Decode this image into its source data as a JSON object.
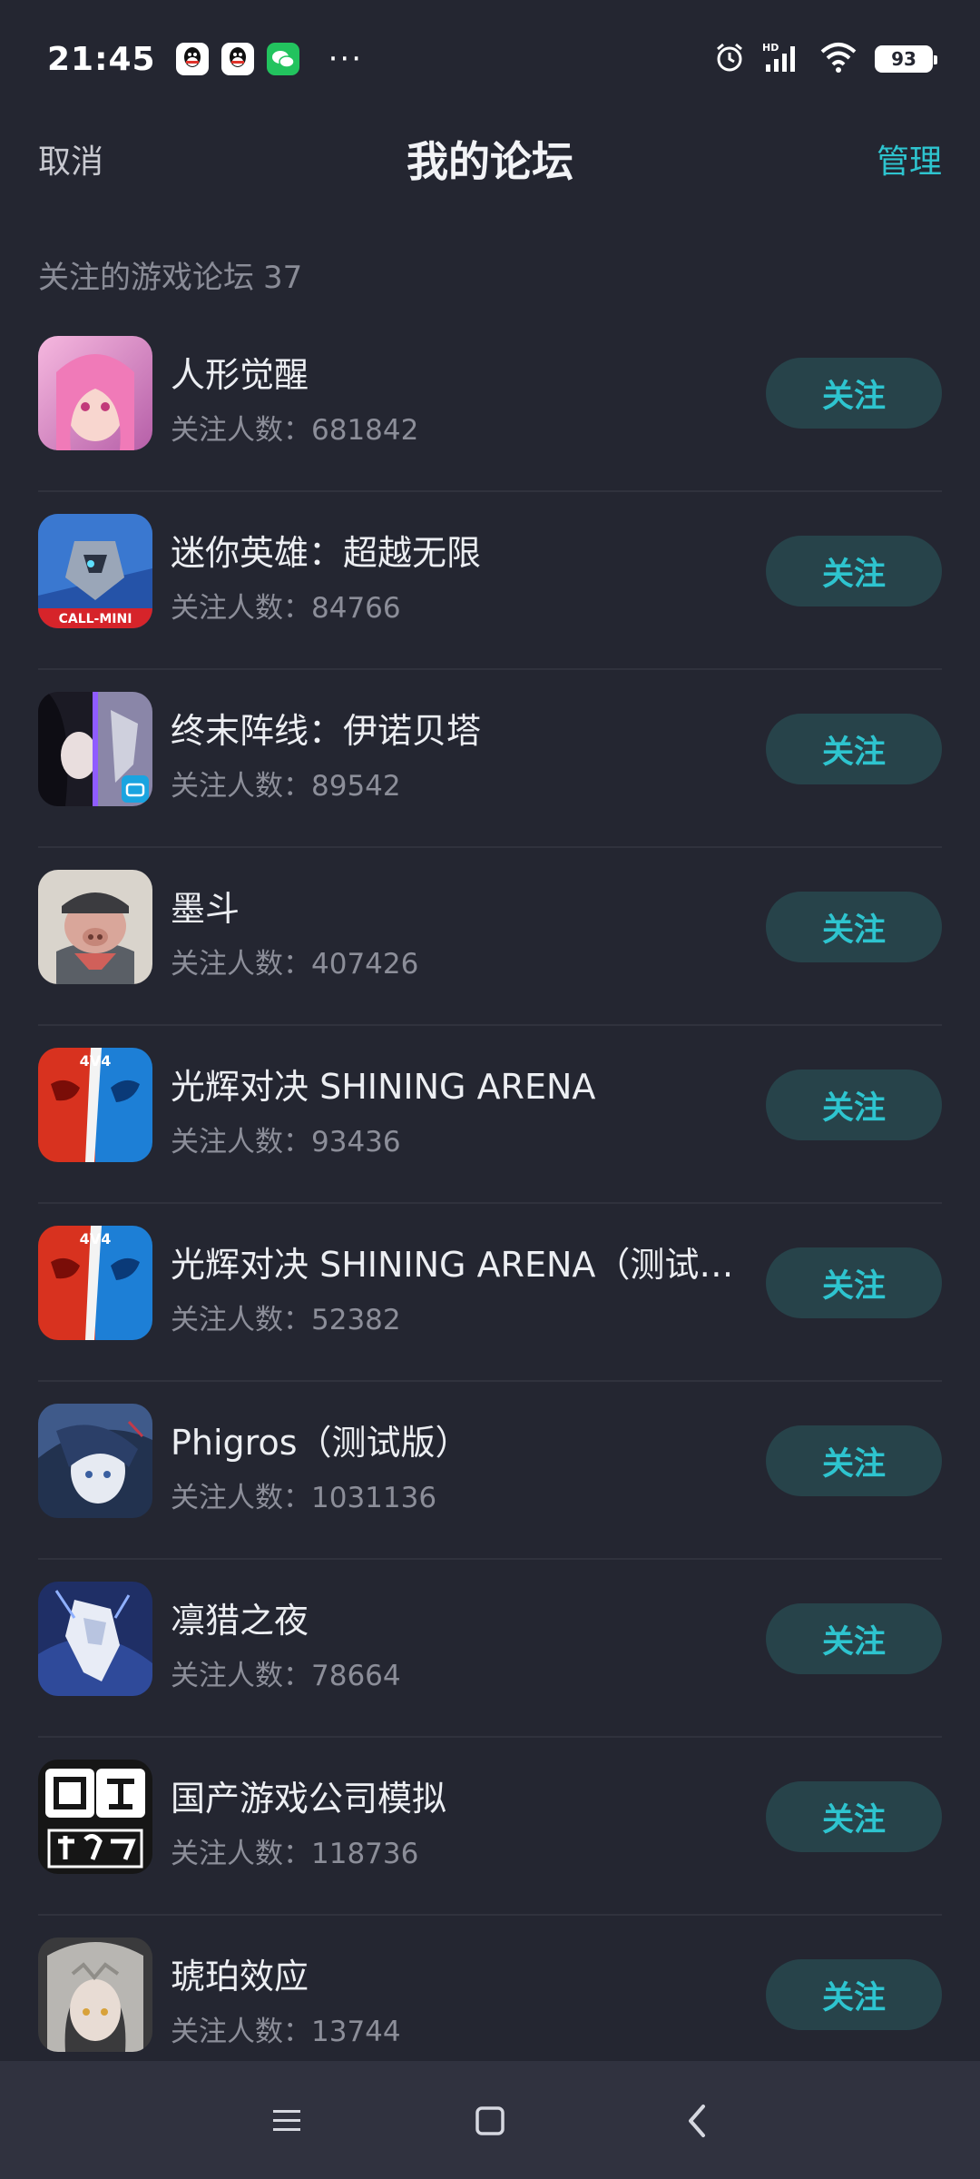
{
  "status_bar": {
    "time": "21:45",
    "notifications": [
      "qq-icon",
      "qq-icon",
      "wechat-icon"
    ],
    "more": "···",
    "battery": "93"
  },
  "header": {
    "cancel": "取消",
    "title": "我的论坛",
    "manage": "管理"
  },
  "section": {
    "label": "关注的游戏论坛",
    "count": "37"
  },
  "follow_label": "关注",
  "items": [
    {
      "name": "人形觉醒",
      "followers": "关注人数：681842",
      "icon_color": "#e88fc8"
    },
    {
      "name": "迷你英雄：超越无限",
      "followers": "关注人数：84766",
      "icon_color": "#2f5fb8"
    },
    {
      "name": "终末阵线：伊诺贝塔",
      "followers": "关注人数：89542",
      "icon_color": "#5a4c8a"
    },
    {
      "name": "墨斗",
      "followers": "关注人数：407426",
      "icon_color": "#c9c4bb"
    },
    {
      "name": "光辉对决 SHINING ARENA",
      "followers": "关注人数：93436",
      "icon_color": "#d8321f"
    },
    {
      "name": "光辉对决 SHINING ARENA（测试版）",
      "followers": "关注人数：52382",
      "icon_color": "#d8321f"
    },
    {
      "name": "Phigros（测试版）",
      "followers": "关注人数：1031136",
      "icon_color": "#3a5685"
    },
    {
      "name": "凛猎之夜",
      "followers": "关注人数：78664",
      "icon_color": "#2c3f7a"
    },
    {
      "name": "国产游戏公司模拟",
      "followers": "关注人数：118736",
      "icon_color": "#1a1a1a"
    },
    {
      "name": "琥珀效应",
      "followers": "关注人数：13744",
      "icon_color": "#6c6a66"
    }
  ],
  "nav": {
    "menu": "menu-icon",
    "home": "home-icon",
    "back": "back-icon"
  }
}
